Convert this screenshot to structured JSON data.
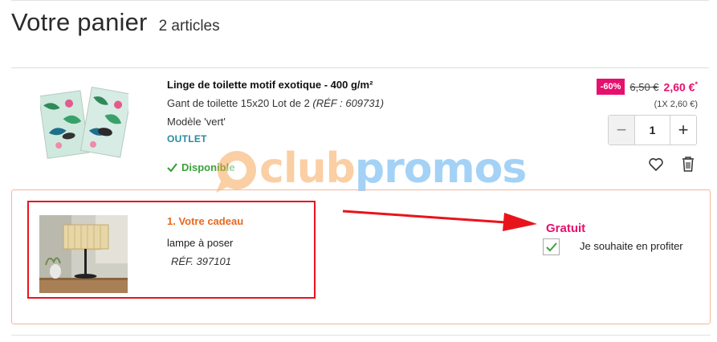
{
  "header": {
    "title": "Votre panier",
    "count": "2 articles"
  },
  "product": {
    "name": "Linge de toilette motif exotique - 400 g/m²",
    "desc_main": "Gant de toilette 15x20 Lot de 2 ",
    "desc_ref": "(RÉF : 609731)",
    "model": "Modèle  'vert'",
    "outlet": "OUTLET",
    "stock": "Disponible",
    "discount": "-60%",
    "old_price": "6,50 €",
    "new_price": "2,60 €",
    "new_price_mark": "*",
    "unit_price": "(1X 2,60 €)",
    "quantity": "1",
    "minus": "−",
    "plus": "+"
  },
  "gift": {
    "title": "1. Votre cadeau",
    "name": "lampe à poser",
    "ref": "RÉF. 397101",
    "free_label": "Gratuit",
    "opt_in_label": "Je souhaite en profiter",
    "opt_in_checked": true
  },
  "watermark": {
    "part1": "club",
    "part2": "promos"
  },
  "colors": {
    "accent_pink": "#e6106e",
    "gift_orange": "#e8691e",
    "outlet_teal": "#2a8aa0",
    "stock_green": "#3aa23a",
    "highlight_red": "#e8141c"
  }
}
